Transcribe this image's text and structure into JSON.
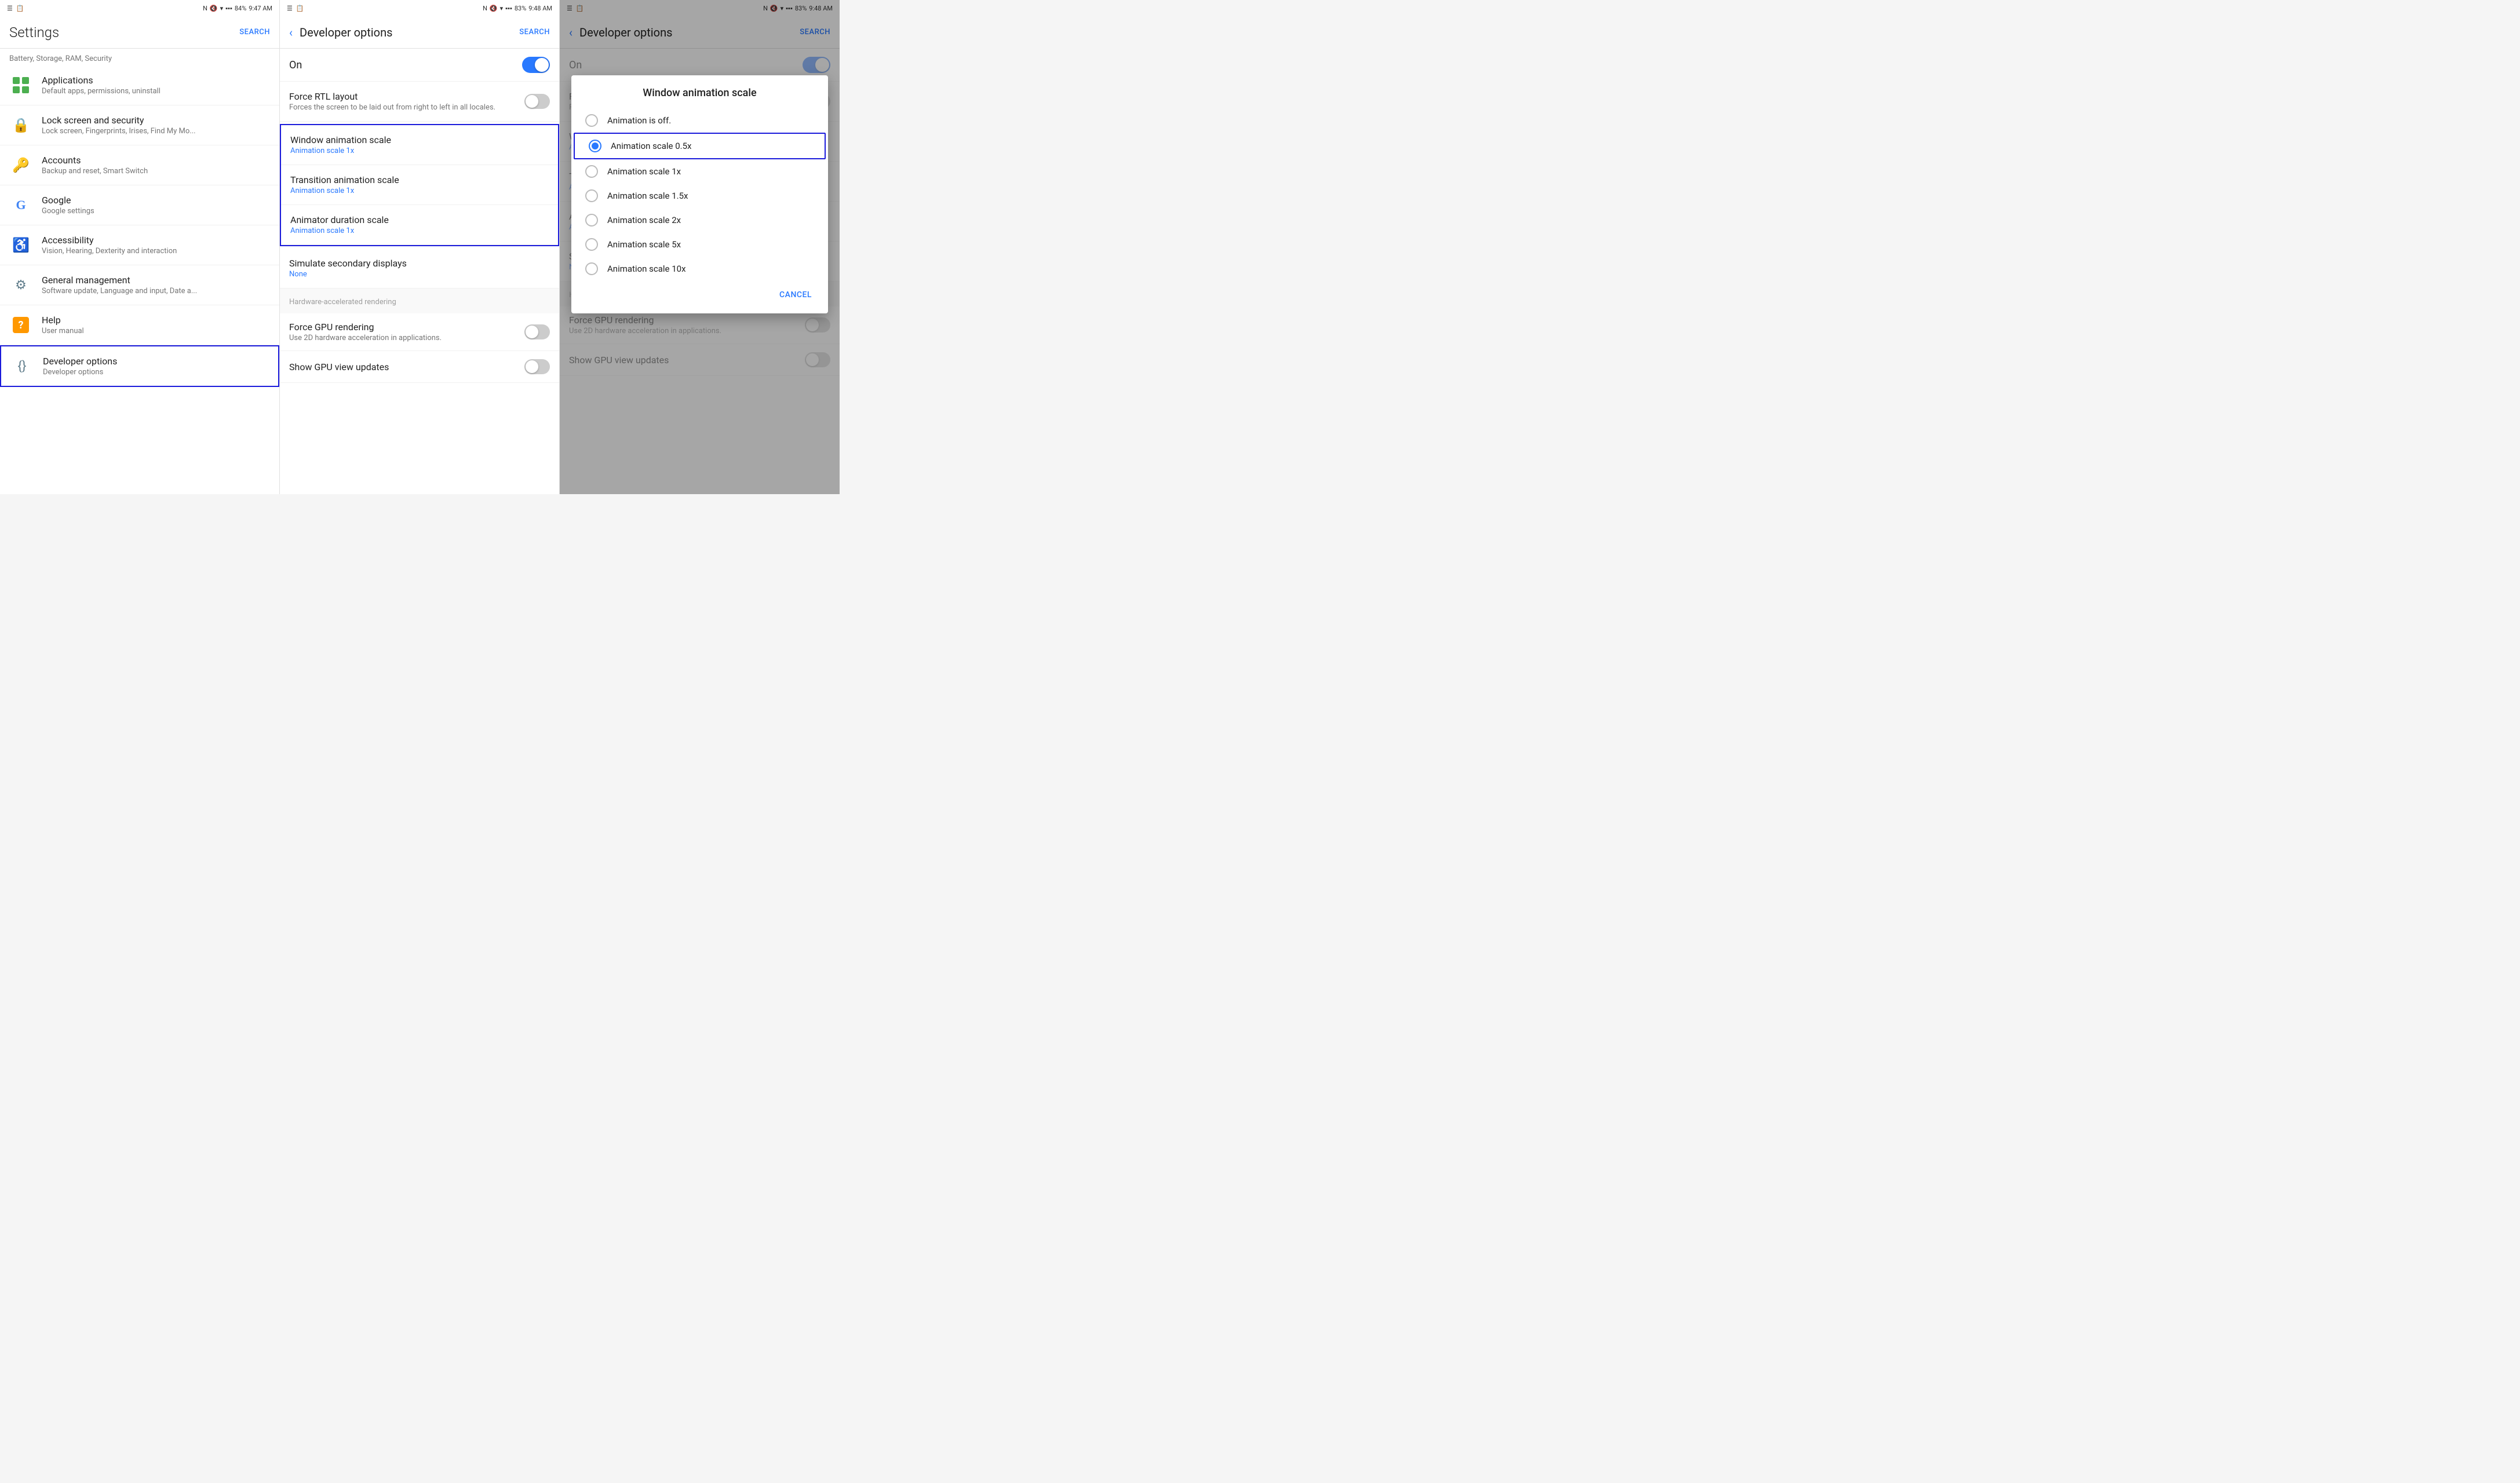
{
  "panel1": {
    "status_bar": {
      "left": [
        "☰",
        "📋"
      ],
      "time": "9:47 AM",
      "battery": "84%",
      "signal": "N"
    },
    "header": {
      "title": "Settings",
      "search_label": "SEARCH"
    },
    "battery_section": "Battery, Storage, RAM, Security",
    "items": [
      {
        "id": "applications",
        "title": "Applications",
        "subtitle": "Default apps, permissions, uninstall",
        "icon": "apps"
      },
      {
        "id": "lock-screen",
        "title": "Lock screen and security",
        "subtitle": "Lock screen, Fingerprints, Irises, Find My Mo...",
        "icon": "lock"
      },
      {
        "id": "accounts",
        "title": "Accounts",
        "subtitle": "Backup and reset, Smart Switch",
        "icon": "person"
      },
      {
        "id": "google",
        "title": "Google",
        "subtitle": "Google settings",
        "icon": "google"
      },
      {
        "id": "accessibility",
        "title": "Accessibility",
        "subtitle": "Vision, Hearing, Dexterity and interaction",
        "icon": "access"
      },
      {
        "id": "general-management",
        "title": "General management",
        "subtitle": "Software update, Language and input, Date a...",
        "icon": "gear"
      },
      {
        "id": "help",
        "title": "Help",
        "subtitle": "User manual",
        "icon": "help"
      },
      {
        "id": "developer-options",
        "title": "Developer options",
        "subtitle": "Developer options",
        "icon": "dev",
        "highlighted": true
      }
    ]
  },
  "panel2": {
    "status_bar": {
      "time": "9:48 AM",
      "battery": "83%"
    },
    "header": {
      "title": "Developer options",
      "search_label": "SEARCH",
      "back": "‹"
    },
    "toggle_label": "On",
    "toggle_on": true,
    "force_rtl": {
      "title": "Force RTL layout",
      "description": "Forces the screen to be laid out from right to left in all locales."
    },
    "animation_items": [
      {
        "title": "Window animation scale",
        "subtitle": "Animation scale 1x",
        "highlighted": true
      },
      {
        "title": "Transition animation scale",
        "subtitle": "Animation scale 1x",
        "highlighted": true
      },
      {
        "title": "Animator duration scale",
        "subtitle": "Animation scale 1x",
        "highlighted": true
      }
    ],
    "simulate_displays": {
      "title": "Simulate secondary displays",
      "subtitle": "None"
    },
    "hardware_rendering_header": "Hardware-accelerated rendering",
    "force_gpu": {
      "title": "Force GPU rendering",
      "description": "Use 2D hardware acceleration in applications."
    },
    "show_gpu_updates": {
      "title": "Show GPU view updates"
    }
  },
  "panel3": {
    "status_bar": {
      "time": "9:48 AM",
      "battery": "83%"
    },
    "header": {
      "title": "Developer options",
      "search_label": "SEARCH",
      "back": "‹"
    },
    "toggle_label": "On",
    "toggle_on": true,
    "force_rtl": {
      "title": "Fo",
      "description": "Fo... left"
    },
    "animation_w": {
      "title": "W",
      "subtitle": "An"
    },
    "animation_t": {
      "title": "Tr",
      "subtitle": "An"
    },
    "animation_a": {
      "title": "An",
      "subtitle": "An"
    },
    "simulate": {
      "title": "Si",
      "subtitle": "No"
    },
    "hardware_header": "Ha",
    "force_gpu": {
      "title": "Force GPU rendering",
      "description": "Use 2D hardware acceleration in applications."
    },
    "show_gpu": {
      "title": "Show GPU view updates"
    },
    "dialog": {
      "title": "Window animation scale",
      "options": [
        {
          "label": "Animation is off.",
          "selected": false
        },
        {
          "label": "Animation scale 0.5x",
          "selected": true
        },
        {
          "label": "Animation scale 1x",
          "selected": false
        },
        {
          "label": "Animation scale 1.5x",
          "selected": false
        },
        {
          "label": "Animation scale 2x",
          "selected": false
        },
        {
          "label": "Animation scale 5x",
          "selected": false
        },
        {
          "label": "Animation scale 10x",
          "selected": false
        }
      ],
      "cancel_label": "CANCEL"
    }
  }
}
